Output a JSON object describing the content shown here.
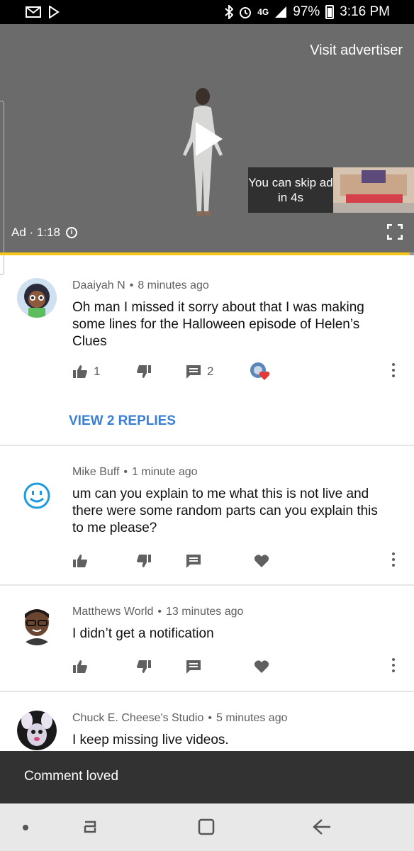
{
  "status_bar": {
    "battery": "97%",
    "time": "3:16 PM",
    "network": "4G"
  },
  "video": {
    "visit_advertiser": "Visit advertiser",
    "skip_text": "You can skip ad in 4s",
    "ad_label": "Ad · 1:18",
    "progress": 0.99
  },
  "comments": [
    {
      "author": "Daaiyah N",
      "time": "8 minutes ago",
      "text": "Oh man I missed it sorry about that I was making some lines for the Halloween episode of Helen’s Clues",
      "likes": "1",
      "replies": "2",
      "view_replies": "VIEW 2 REPLIES"
    },
    {
      "author": "Mike Buff",
      "time": "1 minute ago",
      "text": "um can you explain to me what this is not live and there were some random parts can you explain this to me please?"
    },
    {
      "author": "Matthews World",
      "time": "13 minutes ago",
      "text": "I didn’t get a notification"
    },
    {
      "author": "Chuck E. Cheese's Studio",
      "time": "5 minutes ago",
      "text": "I keep missing live videos."
    }
  ],
  "snackbar": {
    "text": "Comment loved"
  },
  "colors": {
    "accent_blue": "#3a7fd5",
    "progress_yellow": "#f5c518",
    "heart_red": "#e53935"
  }
}
